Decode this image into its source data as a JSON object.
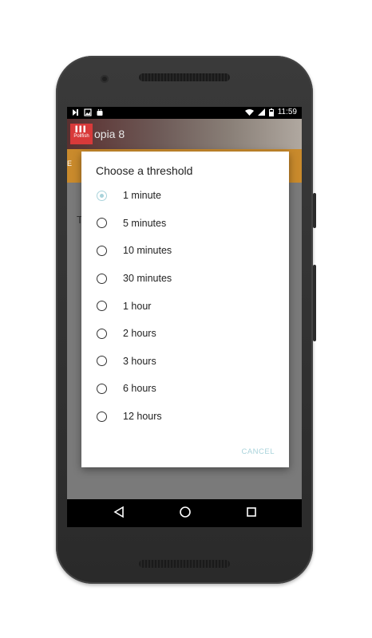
{
  "status_bar": {
    "time": "11:59"
  },
  "app": {
    "title": "opia 8",
    "logo_text": "Pollfish"
  },
  "background": {
    "label_a": "E",
    "label_b": "T"
  },
  "dialog": {
    "title": "Choose a threshold",
    "options": [
      {
        "label": "1 minute",
        "selected": true
      },
      {
        "label": "5 minutes",
        "selected": false
      },
      {
        "label": "10 minutes",
        "selected": false
      },
      {
        "label": "30 minutes",
        "selected": false
      },
      {
        "label": "1 hour",
        "selected": false
      },
      {
        "label": "2 hours",
        "selected": false
      },
      {
        "label": "3 hours",
        "selected": false
      },
      {
        "label": "6 hours",
        "selected": false
      },
      {
        "label": "12 hours",
        "selected": false
      }
    ],
    "cancel_label": "CANCEL"
  },
  "colors": {
    "accent": "#a9d3db",
    "orange": "#c98a2c",
    "logo_red": "#d83a3a"
  },
  "icons": [
    "back-icon",
    "home-icon",
    "recents-icon",
    "wifi-icon",
    "signal-icon",
    "battery-icon"
  ]
}
